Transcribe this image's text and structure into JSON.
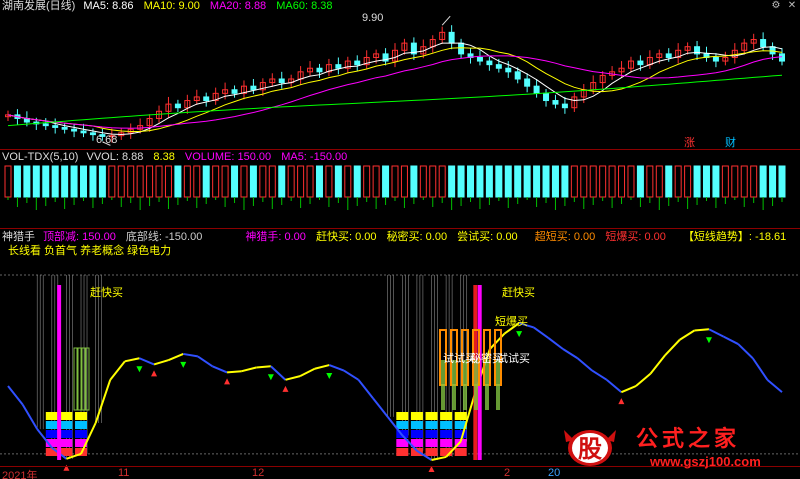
{
  "price_panel": {
    "title": "湖南发展(日线)",
    "ma5": "MA5: 8.86",
    "ma10": "MA10: 9.00",
    "ma20": "MA20: 8.88",
    "ma60": "MA60: 8.38",
    "high_label": "9.90",
    "low_label": "6.68",
    "marker_zhang": "涨",
    "marker_cai": "财",
    "colors": {
      "ma5": "#ffffff",
      "ma10": "#ffff00",
      "ma20": "#ff00ff",
      "ma60": "#00ff00",
      "up": "#ff3030",
      "down": "#54ffff"
    }
  },
  "vol_panel": {
    "title": "VOL-TDX(5,10)",
    "vvol": "VVOL: 8.88",
    "val2": "8.38",
    "volume": "VOLUME: 150.00",
    "ma5": "MA5: -150.00"
  },
  "ind_panel": {
    "title": "神猎手",
    "top": "顶部减: 150.00",
    "bottom": "底部线: -150.00",
    "shen": "神猎手: 0.00",
    "gan": "赶快买: 0.00",
    "mi": "秘密买: 0.00",
    "chang": "尝试买: 0.00",
    "chao": "超短买: 0.00",
    "bao": "短爆买: 0.00",
    "trend": "【短线趋势】: -18.61",
    "line2": "长线看 负首气 养老概念 绿色电力",
    "sig_gan1": "赶快买",
    "sig_gan2": "赶快买",
    "sig_bao": "短爆买",
    "sig_mix1": "试试买",
    "sig_mix2": "秘密买",
    "sig_mix3": "试试买"
  },
  "axis": {
    "t1": "2021年",
    "t2": "11",
    "t3": "12",
    "t4": "2",
    "t5": "20"
  },
  "watermark": {
    "logo": "股",
    "text": "公式之家",
    "url": "www.gszj100.com"
  },
  "chart_data": {
    "type": "candlestick",
    "title": "湖南发展(日线)",
    "price_range": [
      6.68,
      9.9
    ],
    "close": [
      7.3,
      7.2,
      7.1,
      7.05,
      7.0,
      6.95,
      6.9,
      6.85,
      6.8,
      6.75,
      6.7,
      6.72,
      6.8,
      6.9,
      7.0,
      7.2,
      7.4,
      7.6,
      7.5,
      7.7,
      7.8,
      7.7,
      7.9,
      8.0,
      7.9,
      8.1,
      8.0,
      8.2,
      8.3,
      8.2,
      8.3,
      8.5,
      8.6,
      8.5,
      8.7,
      8.6,
      8.8,
      8.7,
      8.9,
      9.0,
      8.8,
      9.1,
      9.3,
      9.0,
      9.2,
      9.4,
      9.6,
      9.3,
      9.0,
      8.9,
      8.8,
      8.7,
      8.6,
      8.5,
      8.3,
      8.1,
      7.9,
      7.7,
      7.6,
      7.5,
      7.8,
      8.0,
      8.2,
      8.4,
      8.5,
      8.6,
      8.8,
      8.7,
      8.9,
      9.0,
      8.9,
      9.1,
      9.2,
      9.0,
      8.9,
      8.8,
      8.9,
      9.1,
      9.3,
      9.4,
      9.2,
      9.0,
      8.8
    ],
    "ma60_end": 8.38,
    "volume_signal": {
      "VVOL": 8.88,
      "VOLUME": 150.0,
      "MA5": -150.0
    },
    "indicator": {
      "顶部减": 150.0,
      "底部线": -150.0,
      "神猎手": 0.0,
      "赶快买": 0.0,
      "秘密买": 0.0,
      "尝试买": 0.0,
      "超短买": 0.0,
      "短爆买": 0.0,
      "短线趋势": -18.61,
      "curve": [
        -30,
        -60,
        -100,
        -130,
        -148,
        -140,
        -90,
        -20,
        10,
        15,
        5,
        12,
        22,
        18,
        2,
        -8,
        -6,
        0,
        2,
        -20,
        -14,
        -2,
        4,
        -5,
        -20,
        -50,
        -80,
        -110,
        -135,
        -150,
        -145,
        -120,
        -40,
        30,
        55,
        72,
        65,
        48,
        30,
        15,
        -5,
        -20,
        -40,
        -30,
        -10,
        20,
        45,
        60,
        62,
        50,
        38,
        15,
        -20,
        -40
      ]
    },
    "x_ticks": [
      "2021年",
      "11",
      "12",
      "2",
      "20"
    ]
  }
}
